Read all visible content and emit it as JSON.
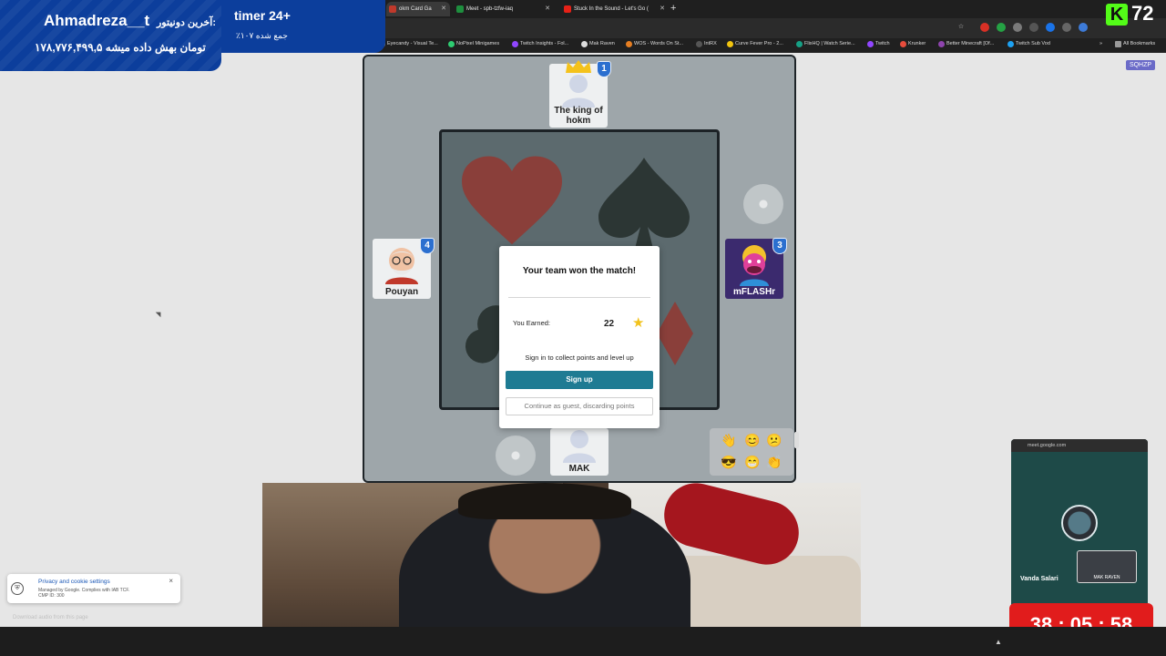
{
  "browser": {
    "tabs": [
      {
        "title": "okm Card Ga",
        "active": true,
        "color": "#c0392b"
      },
      {
        "title": "Meet - spb-tzfw-iaq",
        "active": false,
        "color": "#1e8e3e"
      },
      {
        "title": "Stuck In the Sound - Let's Go (",
        "active": false,
        "color": "#e62117"
      }
    ],
    "bookmarks": [
      "Eyecandy - Visual Te...",
      "NoPixel Minigames",
      "Twitch Insights - Fol...",
      "Mak Raven",
      "WOS - Words On St...",
      "IntRX",
      "Curve Fever Pro - 2...",
      "FlixHQ | Watch Serie...",
      "Twitch",
      "Krunker",
      "Better Minecraft [Of...",
      "Twitch Sub Vod"
    ],
    "all_bookmarks": "All Bookmarks"
  },
  "overlay": {
    "donor_label": "آخرین دونیتور:",
    "donor_name": "Ahmadreza__t",
    "donor_amount": "۱۷۸,۷۷۶,۴۹۹,۵ تومان بهش داده میشه",
    "timer_title": "timer 24+",
    "timer_sub": "٪۱۰۷ جمع شده",
    "kick_logo": "K",
    "viewer_count": "72"
  },
  "page": {
    "room_code": "SQHZP"
  },
  "game": {
    "players": {
      "top": {
        "name": "The king of hokm",
        "badge": "1"
      },
      "left": {
        "name": "Pouyan",
        "badge": "4"
      },
      "right": {
        "name": "mFLASHr",
        "badge": "3"
      },
      "bottom": {
        "name": "MAK"
      }
    },
    "modal": {
      "title": "Your team won the match!",
      "earned_label": "You Earned:",
      "earned_value": "22",
      "signin_text": "Sign in to collect points and level up",
      "signup_label": "Sign up",
      "guest_label": "Continue as guest, discarding points"
    },
    "emojis": [
      "👋",
      "😊",
      "😕",
      "😎",
      "😁",
      "👏"
    ]
  },
  "meet_pip": {
    "url": "meet.google.com",
    "participant_name": "Vanda Salari",
    "tile_name": "MAK RAVEN"
  },
  "countdown": {
    "time": "38 : 05 : 58"
  },
  "cookie_notice": {
    "title": "Privacy and cookie settings",
    "sub1": "Managed by Google. Complies with IAB TCF.",
    "sub2": "CMP ID: 300",
    "close": "×"
  },
  "download_text": "Download audio from this page"
}
